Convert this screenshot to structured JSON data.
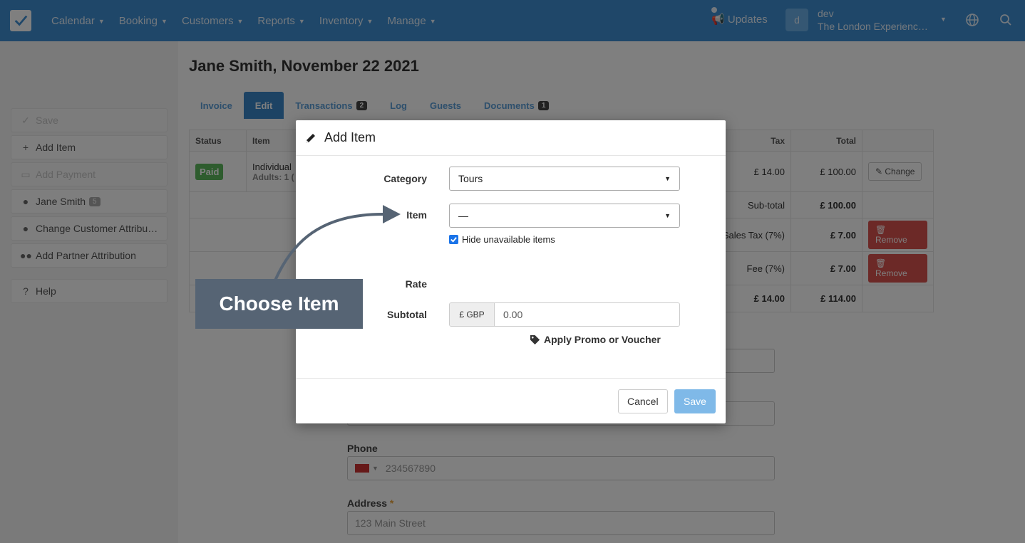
{
  "navbar": {
    "menu": [
      {
        "label": "Calendar"
      },
      {
        "label": "Booking"
      },
      {
        "label": "Customers"
      },
      {
        "label": "Reports"
      },
      {
        "label": "Inventory"
      },
      {
        "label": "Manage"
      }
    ],
    "updates_label": "Updates",
    "avatar_letter": "d",
    "user_name": "dev",
    "company_name": "The London Experienc…"
  },
  "sidebar": {
    "items": [
      {
        "label": "Save",
        "icon": "check-icon"
      },
      {
        "label": "Add Item",
        "icon": "plus-icon"
      },
      {
        "label": "Add Payment",
        "icon": "card-icon"
      },
      {
        "label": "Jane Smith",
        "icon": "user-icon",
        "badge": "5"
      },
      {
        "label": "Change Customer Attribu…",
        "icon": "user-icon"
      },
      {
        "label": "Add Partner Attribution",
        "icon": "users-icon"
      },
      {
        "label": "Help",
        "icon": "question-icon"
      }
    ]
  },
  "page": {
    "title": "Jane Smith, November 22 2021",
    "tabs": [
      {
        "label": "Invoice"
      },
      {
        "label": "Edit",
        "active": true
      },
      {
        "label": "Transactions",
        "count": "2"
      },
      {
        "label": "Log"
      },
      {
        "label": "Guests"
      },
      {
        "label": "Documents",
        "count": "1"
      }
    ]
  },
  "invoice_table": {
    "headers": {
      "status": "Status",
      "item": "Item",
      "tax": "Tax",
      "total": "Total"
    },
    "row": {
      "status": "Paid",
      "item": "Individual",
      "item_sub": "Adults: 1 (",
      "tax": "£ 14.00",
      "total": "£ 100.00",
      "action": "Change"
    },
    "subtotal": {
      "label": "Sub-total",
      "value": "£ 100.00"
    },
    "sales_tax": {
      "label": "Sales Tax (7%)",
      "value": "£ 7.00",
      "action": "Remove"
    },
    "fee": {
      "label": "Fee (7%)",
      "value": "£ 7.00",
      "action": "Remove"
    },
    "totals": {
      "tax": "£ 14.00",
      "total": "£ 114.00"
    }
  },
  "customer_form": {
    "phone_label": "Phone",
    "phone_placeholder": "234567890",
    "address_label": "Address",
    "address_required": "*",
    "address_placeholder": "123 Main Street"
  },
  "modal": {
    "title": "Add Item",
    "category_label": "Category",
    "category_value": "Tours",
    "item_label": "Item",
    "item_value": "—",
    "hide_unavailable_label": "Hide unavailable items",
    "hide_unavailable_checked": true,
    "rate_label": "Rate",
    "subtotal_label": "Subtotal",
    "currency_prefix": "£ GBP",
    "subtotal_value": "0.00",
    "promo_label": "Apply Promo or Voucher",
    "cancel_label": "Cancel",
    "save_label": "Save"
  },
  "callout": {
    "text": "Choose Item"
  },
  "colors": {
    "navbar": "#3e8fd3",
    "primary": "#3a87c9",
    "success": "#5cb85c",
    "danger": "#d9534f",
    "callout": "#566474",
    "save_button": "#7fb9e8"
  }
}
